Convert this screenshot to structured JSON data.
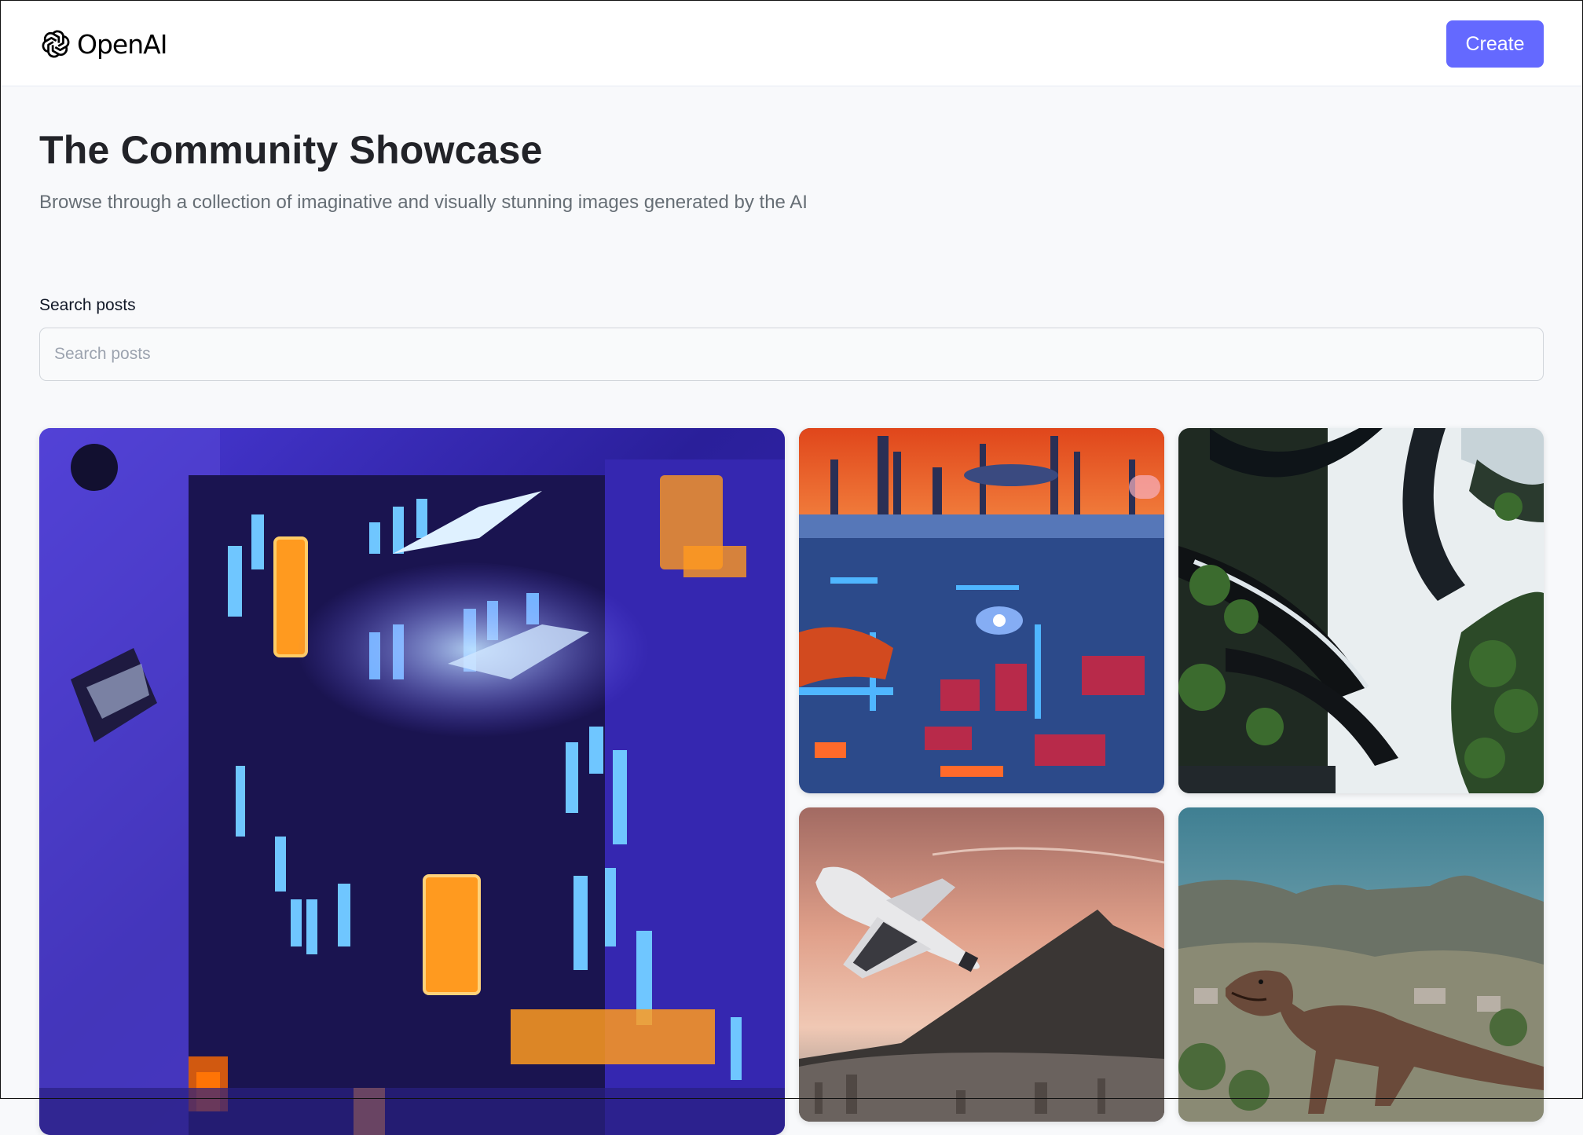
{
  "header": {
    "brand": "OpenAI",
    "logo_icon": "openai-logo-icon",
    "create_label": "Create",
    "accent_color": "#6469ff"
  },
  "main": {
    "title": "The Community Showcase",
    "subtitle": "Browse through a collection of imaginative and visually stunning images generated by the AI"
  },
  "search": {
    "label": "Search posts",
    "placeholder": "Search posts",
    "value": ""
  },
  "gallery": {
    "cards": [
      {
        "image": "neon-cyberpunk-city-with-flying-ships"
      },
      {
        "image": "futuristic-city-orange-sky-painting"
      },
      {
        "image": "green-organic-futuristic-towers"
      },
      {
        "image": "space-shuttle-over-mountain-city"
      },
      {
        "image": "dinosaur-figure-with-table-mountain"
      }
    ]
  }
}
